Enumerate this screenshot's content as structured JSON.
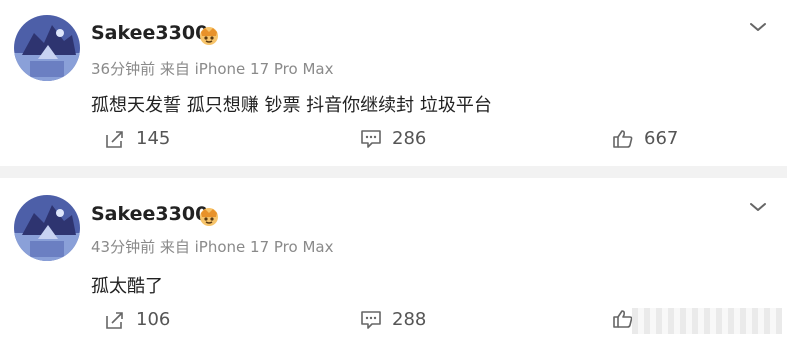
{
  "posts": [
    {
      "username": "Sakee3300",
      "time": "36分钟前",
      "source": "来自 iPhone 17 Pro Max",
      "content": "孤想天发誓 孤只想赚 钞票 抖音你继续封 垃圾平台",
      "shares": "145",
      "comments": "286",
      "likes": "667"
    },
    {
      "username": "Sakee3300",
      "time": "43分钟前",
      "source": "来自 iPhone 17 Pro Max",
      "content": "孤太酷了",
      "shares": "106",
      "comments": "288"
    }
  ],
  "icons": {
    "share": "share-icon",
    "comment": "comment-icon",
    "like": "like-icon",
    "more": "chevron-down-icon",
    "badge": "vip-crown-badge-icon"
  },
  "colors": {
    "text": "#222222",
    "meta": "#8a8a8a",
    "badge": "#f0a23a",
    "divider": "#f2f2f2"
  }
}
